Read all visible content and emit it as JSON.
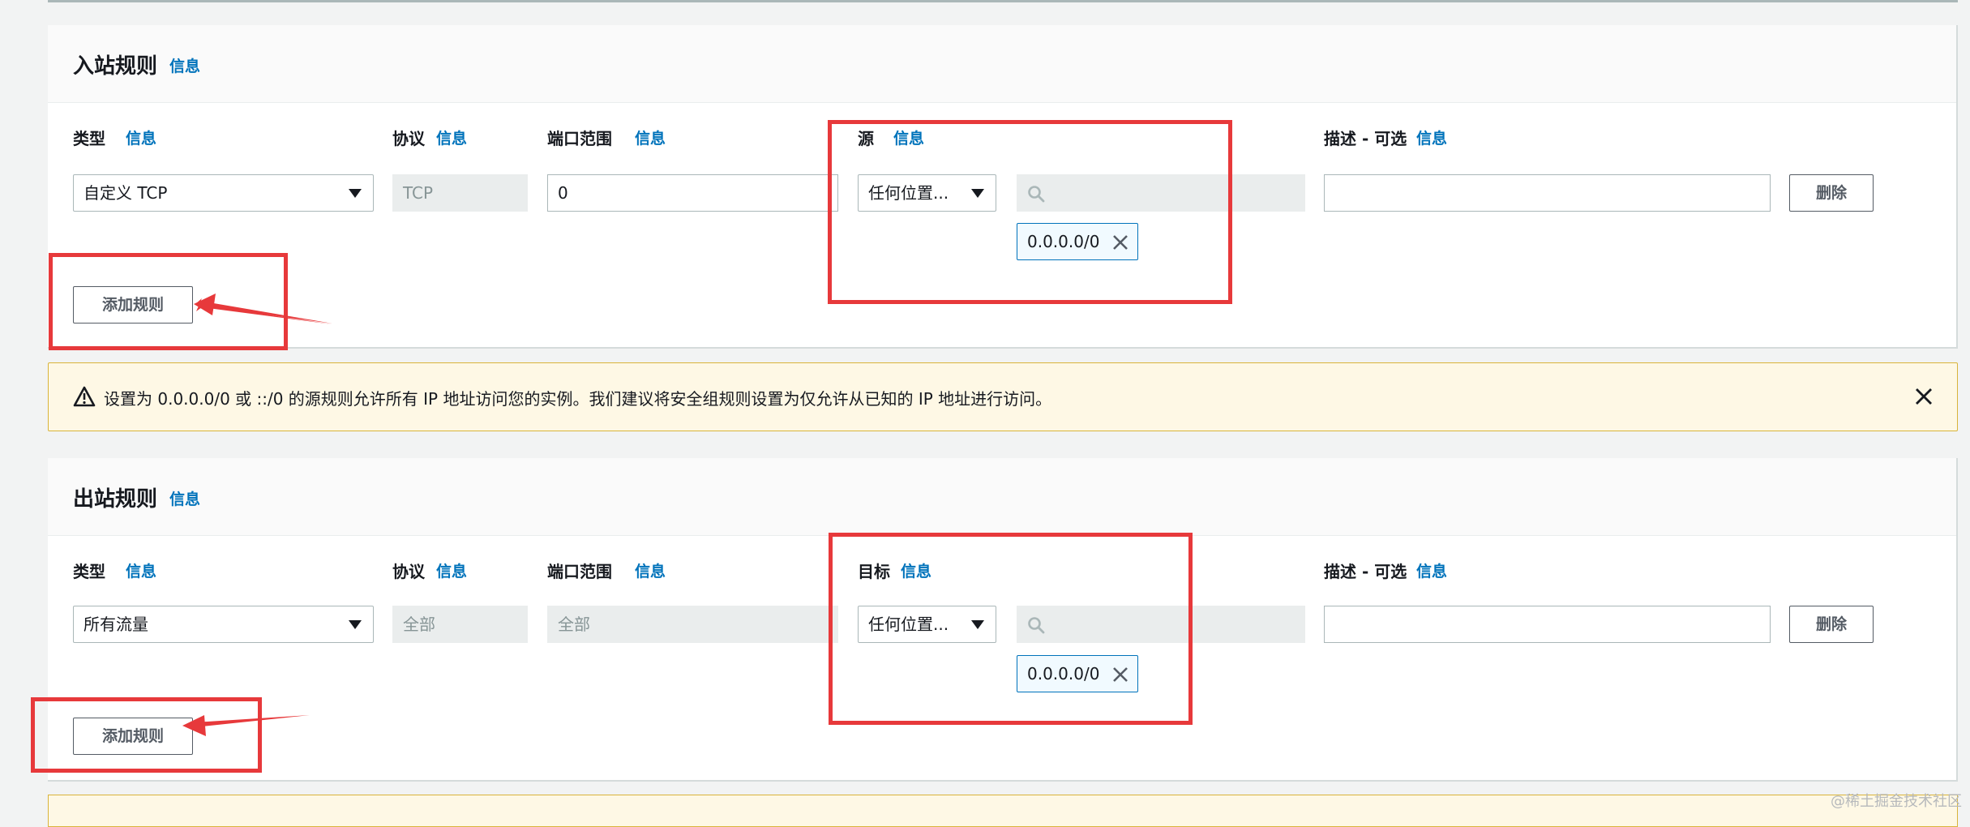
{
  "info_label": "信息",
  "inbound": {
    "title": "入站规则",
    "headers": {
      "type": "类型",
      "protocol": "协议",
      "port": "端口范围",
      "source": "源",
      "description": "描述 - 可选"
    },
    "row": {
      "type": "自定义 TCP",
      "protocol": "TCP",
      "port": "0",
      "source_select": "任何位置...",
      "cidr_token": "0.0.0.0/0",
      "description": "",
      "delete_label": "删除"
    },
    "add_rule_label": "添加规则"
  },
  "warning": {
    "text": "设置为 0.0.0.0/0 或 ::/0 的源规则允许所有 IP 地址访问您的实例。我们建议将安全组规则设置为仅允许从已知的 IP 地址进行访问。"
  },
  "outbound": {
    "title": "出站规则",
    "headers": {
      "type": "类型",
      "protocol": "协议",
      "port": "端口范围",
      "destination": "目标",
      "description": "描述 - 可选"
    },
    "row": {
      "type": "所有流量",
      "protocol": "全部",
      "port": "全部",
      "destination_select": "任何位置...",
      "cidr_token": "0.0.0.0/0",
      "description": "",
      "delete_label": "删除"
    },
    "add_rule_label": "添加规则"
  },
  "watermark": "@稀土掘金技术社区",
  "colors": {
    "accent": "#0073bb",
    "annotation_red": "#e7393b",
    "warning_bg": "#fef8e5"
  },
  "icons": {
    "warning": "warning-triangle-icon",
    "close": "close-icon",
    "search": "search-icon",
    "dropdown": "caret-down-icon"
  }
}
